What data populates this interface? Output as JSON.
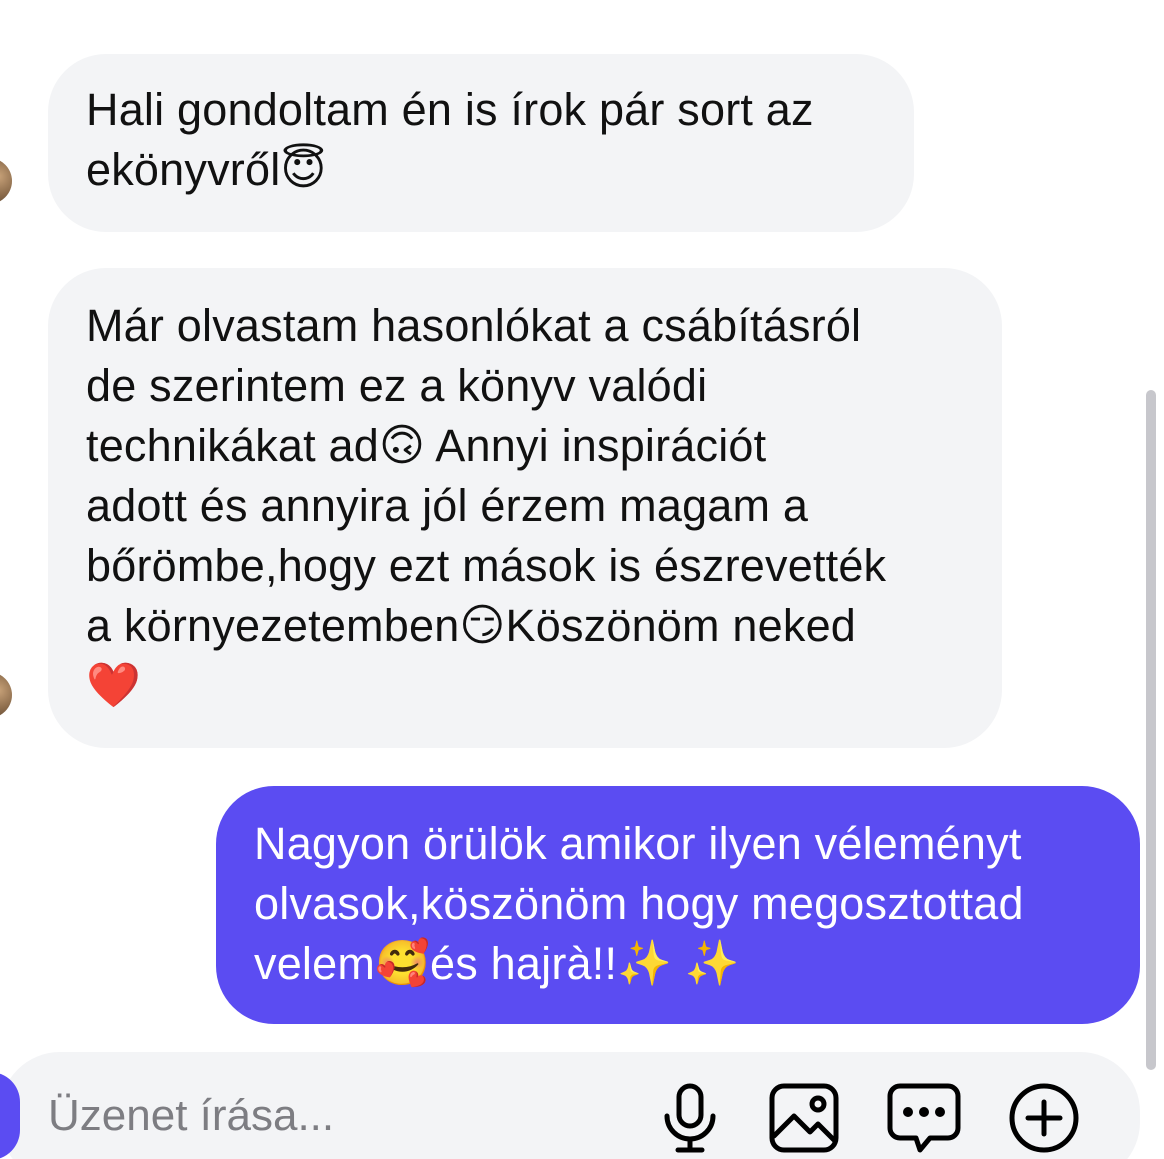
{
  "conversation": {
    "messages": [
      {
        "direction": "incoming",
        "lines": [
          [
            "Hali gondoltam én is írok pár sort az"
          ],
          [
            "ekönyvről",
            "😇"
          ]
        ]
      },
      {
        "direction": "incoming",
        "lines": [
          [
            "Már olvastam hasonlókat a csábításról"
          ],
          [
            "de szerintem ez a könyv valódi"
          ],
          [
            "technikákat ad",
            "🙃",
            " Annyi inspirációt"
          ],
          [
            "adott és annyira jól érzem magam a"
          ],
          [
            "bőrömbe,hogy ezt mások is észrevették"
          ],
          [
            "a környezetemben",
            "😏",
            "Köszönöm neked"
          ],
          [
            "❤️"
          ]
        ]
      },
      {
        "direction": "outgoing",
        "lines": [
          [
            "Nagyon örülök amikor ilyen véleményt"
          ],
          [
            "olvasok,köszönöm hogy megosztottad"
          ],
          [
            "velem",
            "🥰",
            "és hajrà!!",
            "✨",
            " ",
            "✨"
          ]
        ]
      }
    ]
  },
  "composer": {
    "placeholder": "Üzenet írása...",
    "icons": [
      "microphone-icon",
      "image-icon",
      "sticker-icon",
      "add-icon"
    ]
  },
  "colors": {
    "outgoing_bubble": "#5b4cf2",
    "incoming_bubble": "#f3f4f6",
    "text_dark": "#111111",
    "placeholder": "#7d7d82"
  }
}
